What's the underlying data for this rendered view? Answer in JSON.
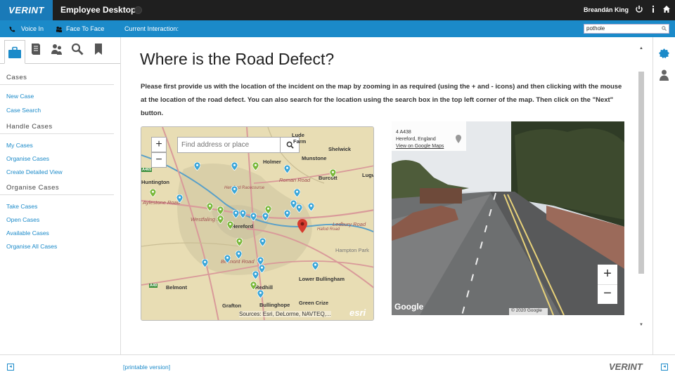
{
  "header": {
    "logo": "VERINT",
    "app_title": "Employee Desktop",
    "user_name": "Breandán King"
  },
  "subbar": {
    "voice_in": "Voice In",
    "face_to_face": "Face To Face",
    "current_interaction": "Current Interaction:",
    "search_value": "pothole"
  },
  "sidebar": {
    "sections": [
      {
        "title": "Cases",
        "items": [
          "New Case",
          "Case Search"
        ]
      },
      {
        "title": "Handle Cases",
        "items": [
          "My Cases",
          "Organise Cases",
          "Create Detailed View"
        ]
      },
      {
        "title": "Organise Cases",
        "items": [
          "Take Cases",
          "Open Cases",
          "Available Cases",
          "Organise All Cases"
        ]
      }
    ]
  },
  "main": {
    "title": "Where is the Road Defect?",
    "instructions": "Please first provide us with the location of the incident on the map by zooming in as required (using the + and - icons) and then clicking with the mouse at the location of the road defect.  You can also search for the location using the search box in the top left corner of the map.  Then click on the \"Next\" button."
  },
  "map": {
    "search_placeholder": "Find address or place",
    "zoom_in": "+",
    "zoom_out": "−",
    "attribution": "Sources: Esri, DeLorme, NAVTEQ,...",
    "esri_logo": "esri",
    "places": [
      "Lude",
      "Farm",
      "Shelwick",
      "Holmer",
      "Munstone",
      "Burcott",
      "Lugwardine",
      "Huntington",
      "Hereford Racecourse",
      "Aylestone Road",
      "Hereford",
      "Ledbury Road",
      "Hampton Park",
      "Lower Bullingham",
      "Belmont",
      "Grafton",
      "Bullinghope",
      "Green Crize",
      "Redhill",
      "Roman Road",
      "Westfaling St",
      "Belmont Road",
      "Hafod Road"
    ],
    "roads": [
      "A465",
      "A49",
      "A4103",
      "A438"
    ]
  },
  "streetview": {
    "address_line1": "4 A438",
    "address_line2": "Hereford, England",
    "maps_link": "View on Google Maps",
    "brand": "Google",
    "copyright": "© 2020 Google",
    "zoom_in": "+",
    "zoom_out": "−"
  },
  "footer": {
    "printable": "[printable version]",
    "logo": "VERINT"
  },
  "colors": {
    "accent": "#1b8ac9",
    "topbar": "#1f1f1f",
    "pin_blue": "#3aa6d8",
    "pin_green": "#7ab83a",
    "pin_red": "#d63b2f"
  }
}
